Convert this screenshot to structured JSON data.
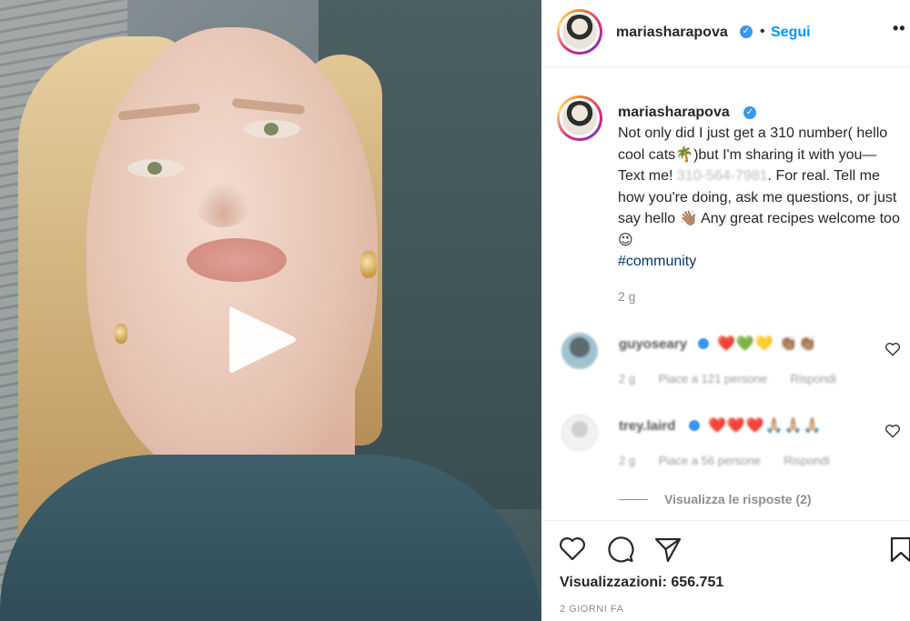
{
  "header": {
    "username": "mariasharapova",
    "separator": "•",
    "follow_label": "Segui",
    "more_label": "••"
  },
  "caption": {
    "username": "mariasharapova",
    "text_part1": "Not only did I just get a 310 number( hello cool cats🌴)but I'm sharing it with you—Text me! ",
    "phone": "310-564-7981",
    "text_part2": ". For real. Tell me how you're doing, ask me questions, or just say hello 👋🏽 Any great recipes welcome too 😉",
    "hashtag": "#community",
    "time": "2 g"
  },
  "comments": [
    {
      "username": "guyoseary",
      "emojis": "❤️💚💛 👏🏽👏🏽",
      "time": "2 g",
      "likes": "Piace a 121 persone",
      "reply": "Rispondi"
    },
    {
      "username": "trey.laird",
      "emojis": "❤️❤️❤️🙏🏼🙏🏼🙏🏼",
      "time": "2 g",
      "likes": "Piace a 56 persone",
      "reply": "Rispondi"
    }
  ],
  "replies_label": "Visualizza le risposte (2)",
  "actions": {
    "views": "Visualizzazioni: 656.751",
    "date": "2 GIORNI FA"
  },
  "colors": {
    "link_blue": "#0095f6",
    "verified_blue": "#3897f0",
    "muted_text": "#8e8e8e",
    "hashtag": "#00376b"
  }
}
